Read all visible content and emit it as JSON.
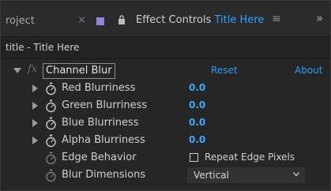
{
  "tabs": {
    "project_label": "roject",
    "close_glyph": "×",
    "effect_label_prefix": "Effect Controls",
    "effect_label_accent": "Title Here",
    "menu_glyph": "≡",
    "overflow_glyph": "»",
    "label_color": "#8f86d8",
    "accent_color": "#29a3ff"
  },
  "subheader": "title - Title Here",
  "effect": {
    "fx_glyph": "fx",
    "name": "Channel Blur",
    "reset_label": "Reset",
    "about_label": "About"
  },
  "properties": [
    {
      "label": "Red Blurriness",
      "value": "0.0"
    },
    {
      "label": "Green Blurriness",
      "value": "0.0"
    },
    {
      "label": "Blue Blurriness",
      "value": "0.0"
    },
    {
      "label": "Alpha Blurriness",
      "value": "0.0"
    }
  ],
  "edge_behavior": {
    "label": "Edge Behavior",
    "checkbox_label": "Repeat Edge Pixels",
    "checked": false
  },
  "blur_dimensions": {
    "label": "Blur Dimensions",
    "selected": "Vertical"
  }
}
